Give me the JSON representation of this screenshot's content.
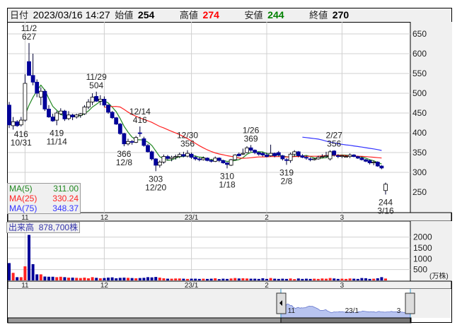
{
  "header": {
    "date_label": "日付",
    "datetime": "2023/03/16 14:27",
    "open_label": "始値",
    "open": "254",
    "high_label": "高値",
    "high": "274",
    "low_label": "安値",
    "low": "244",
    "close_label": "終値",
    "close": "270"
  },
  "colors": {
    "up_candle": "#ffffff",
    "down_candle": "#000099",
    "ma5": "#228822",
    "ma25": "#ff2222",
    "ma75": "#3333ff",
    "vol_up": "#ff2222",
    "vol_down": "#000099",
    "high_value": "#ff0000",
    "low_value": "#008000"
  },
  "legend": [
    {
      "name": "MA(5)",
      "value": "311.00"
    },
    {
      "name": "MA(25)",
      "value": "330.24"
    },
    {
      "name": "MA(75)",
      "value": "348.37"
    }
  ],
  "volume_label": {
    "name": "出来高",
    "value": "878,700株"
  },
  "volume_unit": "(万株)",
  "chart_data": {
    "type": "candlestick",
    "price_ticks": [
      650,
      600,
      550,
      500,
      450,
      400,
      350,
      300,
      250
    ],
    "volume_ticks": [
      2000,
      1500,
      1000,
      500
    ],
    "month_labels": [
      {
        "label": "11",
        "date": "11/1"
      },
      {
        "label": "12",
        "date": "12/1"
      },
      {
        "label": "23/1",
        "date": "1/4"
      },
      {
        "label": "2",
        "date": "2/1"
      },
      {
        "label": "3",
        "date": "3/1"
      }
    ],
    "navigator_labels": [
      {
        "label": "11",
        "date": "11/1"
      },
      {
        "label": "23/1",
        "date": "1/4"
      },
      {
        "label": "3",
        "date": "3/1"
      }
    ],
    "annotations": [
      {
        "date": "11/2",
        "value": "627",
        "text": "11/2",
        "pos": "above"
      },
      {
        "date": "10/31",
        "value": "416",
        "text": "10/31",
        "pos": "below"
      },
      {
        "date": "11/14",
        "value": "419",
        "text": "11/14",
        "pos": "below"
      },
      {
        "date": "11/29",
        "value": "504",
        "text": "11/29",
        "pos": "above"
      },
      {
        "date": "12/8",
        "value": "366",
        "text": "12/8",
        "pos": "below"
      },
      {
        "date": "12/14",
        "value": "416",
        "text": "12/14",
        "pos": "above"
      },
      {
        "date": "12/20",
        "value": "303",
        "text": "12/20",
        "pos": "below"
      },
      {
        "date": "12/30",
        "value": "356",
        "text": "12/30",
        "pos": "above"
      },
      {
        "date": "1/18",
        "value": "310",
        "text": "1/18",
        "pos": "below"
      },
      {
        "date": "1/26",
        "value": "369",
        "text": "1/26",
        "pos": "above"
      },
      {
        "date": "2/8",
        "value": "319",
        "text": "2/8",
        "pos": "below"
      },
      {
        "date": "2/27",
        "value": "356",
        "text": "2/27",
        "pos": "above"
      },
      {
        "date": "3/16",
        "value": "244",
        "text": "3/16",
        "pos": "below"
      }
    ],
    "columns": [
      "date",
      "open",
      "high",
      "low",
      "close",
      "volume_10k"
    ],
    "candles": [
      [
        "10/26",
        470,
        478,
        412,
        420,
        800
      ],
      [
        "10/27",
        418,
        440,
        408,
        428,
        350
      ],
      [
        "10/28",
        428,
        432,
        415,
        418,
        150
      ],
      [
        "10/31",
        420,
        440,
        416,
        432,
        150
      ],
      [
        "11/1",
        432,
        548,
        428,
        525,
        650
      ],
      [
        "11/2",
        580,
        627,
        545,
        545,
        2100
      ],
      [
        "11/4",
        545,
        600,
        520,
        528,
        750
      ],
      [
        "11/7",
        528,
        535,
        490,
        500,
        280
      ],
      [
        "11/8",
        490,
        515,
        470,
        505,
        280
      ],
      [
        "11/9",
        505,
        510,
        455,
        460,
        180
      ],
      [
        "11/10",
        460,
        470,
        438,
        440,
        170
      ],
      [
        "11/11",
        440,
        448,
        428,
        430,
        170
      ],
      [
        "11/14",
        432,
        455,
        419,
        450,
        150
      ],
      [
        "11/15",
        448,
        462,
        445,
        455,
        170
      ],
      [
        "11/16",
        455,
        458,
        430,
        435,
        150
      ],
      [
        "11/17",
        436,
        455,
        432,
        445,
        130
      ],
      [
        "11/18",
        445,
        448,
        432,
        440,
        130
      ],
      [
        "11/21",
        440,
        448,
        436,
        445,
        120
      ],
      [
        "11/22",
        444,
        450,
        438,
        448,
        110
      ],
      [
        "11/24",
        448,
        470,
        445,
        465,
        130
      ],
      [
        "11/25",
        465,
        485,
        460,
        478,
        100
      ],
      [
        "11/28",
        478,
        500,
        470,
        490,
        150
      ],
      [
        "11/29",
        492,
        504,
        478,
        480,
        120
      ],
      [
        "11/30",
        480,
        495,
        470,
        485,
        100
      ],
      [
        "12/1",
        485,
        492,
        465,
        470,
        110
      ],
      [
        "12/2",
        470,
        472,
        448,
        452,
        130
      ],
      [
        "12/5",
        452,
        455,
        435,
        438,
        140
      ],
      [
        "12/6",
        438,
        440,
        420,
        422,
        100
      ],
      [
        "12/7",
        422,
        425,
        395,
        398,
        120
      ],
      [
        "12/8",
        398,
        400,
        366,
        372,
        130
      ],
      [
        "12/9",
        372,
        385,
        368,
        378,
        120
      ],
      [
        "12/12",
        378,
        382,
        370,
        376,
        110
      ],
      [
        "12/13",
        376,
        392,
        374,
        388,
        100
      ],
      [
        "12/14",
        400,
        416,
        390,
        398,
        110
      ],
      [
        "12/15",
        385,
        390,
        365,
        368,
        120
      ],
      [
        "12/16",
        368,
        372,
        350,
        352,
        150
      ],
      [
        "12/19",
        352,
        355,
        330,
        334,
        140
      ],
      [
        "12/20",
        334,
        336,
        303,
        318,
        160
      ],
      [
        "12/21",
        318,
        330,
        312,
        326,
        130
      ],
      [
        "12/22",
        326,
        345,
        322,
        340,
        100
      ],
      [
        "12/23",
        340,
        344,
        330,
        335,
        80
      ],
      [
        "12/26",
        335,
        342,
        328,
        338,
        80
      ],
      [
        "12/27",
        338,
        345,
        332,
        340,
        90
      ],
      [
        "12/28",
        340,
        350,
        336,
        345,
        90
      ],
      [
        "12/29",
        345,
        352,
        338,
        341,
        80
      ],
      [
        "12/30",
        341,
        356,
        338,
        348,
        70
      ],
      [
        "1/4",
        346,
        350,
        334,
        338,
        80
      ],
      [
        "1/5",
        338,
        342,
        330,
        334,
        80
      ],
      [
        "1/6",
        334,
        338,
        328,
        332,
        70
      ],
      [
        "1/10",
        332,
        340,
        330,
        336,
        80
      ],
      [
        "1/11",
        336,
        338,
        328,
        330,
        70
      ],
      [
        "1/12",
        330,
        334,
        325,
        328,
        80
      ],
      [
        "1/13",
        328,
        340,
        326,
        336,
        100
      ],
      [
        "1/16",
        336,
        338,
        326,
        330,
        60
      ],
      [
        "1/17",
        330,
        332,
        322,
        324,
        80
      ],
      [
        "1/18",
        324,
        326,
        310,
        320,
        70
      ],
      [
        "1/19",
        318,
        334,
        316,
        332,
        90
      ],
      [
        "1/20",
        332,
        346,
        330,
        344,
        110
      ],
      [
        "1/23",
        346,
        350,
        340,
        342,
        90
      ],
      [
        "1/24",
        346,
        360,
        344,
        348,
        100
      ],
      [
        "1/25",
        350,
        366,
        348,
        362,
        90
      ],
      [
        "1/26",
        362,
        369,
        352,
        356,
        80
      ],
      [
        "1/27",
        356,
        358,
        346,
        350,
        80
      ],
      [
        "1/30",
        350,
        352,
        342,
        346,
        70
      ],
      [
        "1/31",
        348,
        352,
        340,
        344,
        100
      ],
      [
        "2/1",
        344,
        350,
        338,
        340,
        70
      ],
      [
        "2/2",
        342,
        370,
        340,
        348,
        110
      ],
      [
        "2/3",
        348,
        350,
        338,
        342,
        80
      ],
      [
        "2/6",
        350,
        354,
        340,
        344,
        70
      ],
      [
        "2/7",
        342,
        344,
        330,
        334,
        80
      ],
      [
        "2/8",
        332,
        336,
        319,
        330,
        70
      ],
      [
        "2/9",
        330,
        350,
        324,
        346,
        90
      ],
      [
        "2/10",
        346,
        356,
        340,
        352,
        60
      ],
      [
        "2/13",
        352,
        354,
        338,
        342,
        90
      ],
      [
        "2/14",
        342,
        346,
        336,
        338,
        70
      ],
      [
        "2/15",
        338,
        342,
        332,
        336,
        80
      ],
      [
        "2/16",
        334,
        338,
        328,
        332,
        70
      ],
      [
        "2/17",
        332,
        336,
        330,
        334,
        80
      ],
      [
        "2/20",
        334,
        342,
        332,
        338,
        70
      ],
      [
        "2/21",
        338,
        346,
        336,
        340,
        90
      ],
      [
        "2/22",
        340,
        352,
        336,
        342,
        80
      ],
      [
        "2/24",
        334,
        356,
        330,
        352,
        110
      ],
      [
        "2/27",
        354,
        356,
        340,
        344,
        90
      ],
      [
        "2/28",
        342,
        346,
        336,
        340,
        70
      ],
      [
        "3/1",
        340,
        344,
        336,
        342,
        80
      ],
      [
        "3/2",
        340,
        344,
        338,
        340,
        70
      ],
      [
        "3/3",
        340,
        348,
        336,
        344,
        90
      ],
      [
        "3/6",
        344,
        346,
        338,
        340,
        80
      ],
      [
        "3/7",
        340,
        342,
        334,
        336,
        70
      ],
      [
        "3/8",
        336,
        340,
        330,
        332,
        110
      ],
      [
        "3/9",
        332,
        334,
        326,
        328,
        100
      ],
      [
        "3/10",
        330,
        332,
        320,
        324,
        70
      ],
      [
        "3/13",
        324,
        330,
        318,
        326,
        80
      ],
      [
        "3/14",
        326,
        328,
        314,
        316,
        100
      ],
      [
        "3/15",
        316,
        318,
        308,
        311,
        150
      ],
      [
        "3/16",
        254,
        274,
        244,
        270,
        87.87
      ]
    ],
    "moving_averages": [
      5,
      25,
      75
    ]
  }
}
